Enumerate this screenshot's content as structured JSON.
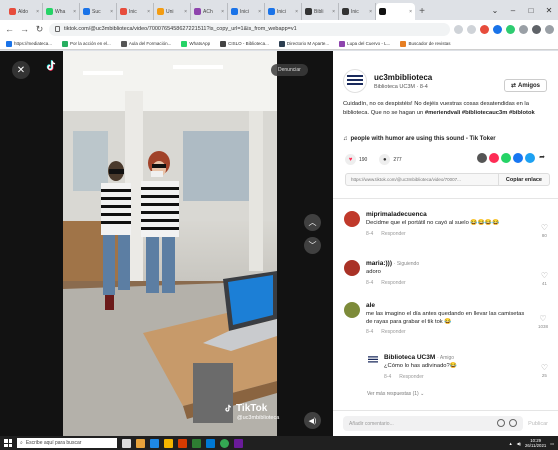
{
  "browser": {
    "tabs": [
      {
        "label": "Aldo",
        "color": "#e74c3c"
      },
      {
        "label": "Wha",
        "color": "#25d366"
      },
      {
        "label": "Suc",
        "color": "#1a73e8"
      },
      {
        "label": "Inic",
        "color": "#e74c3c"
      },
      {
        "label": "Uni",
        "color": "#f39c12"
      },
      {
        "label": "ACh",
        "color": "#8e44ad"
      },
      {
        "label": "Inici",
        "color": "#1a73e8"
      },
      {
        "label": "Inici",
        "color": "#1a73e8"
      },
      {
        "label": "Bibli",
        "color": "#333333"
      },
      {
        "label": "Inic",
        "color": "#333333"
      },
      {
        "label": "",
        "color": "#111111",
        "active": true
      }
    ],
    "new_tab": "+",
    "url": "tiktok.com/@uc3mbiblioteca/video/7000765458627221511?is_copy_url=1&is_from_webapp=v1",
    "bookmarks": [
      {
        "label": "https://mediateca...",
        "color": "#1a73e8"
      },
      {
        "label": "Por la acción en el...",
        "color": "#27ae60"
      },
      {
        "label": "Aula del Formación...",
        "color": "#555555"
      },
      {
        "label": "WhatsApp",
        "color": "#25d366"
      },
      {
        "label": "CISLO - Biblioteca...",
        "color": "#444444"
      },
      {
        "label": "Directorio M Aparte...",
        "color": "#2c3e50"
      },
      {
        "label": "Lupa del Cuervo - L...",
        "color": "#8e44ad"
      },
      {
        "label": "Buscador de revistas",
        "color": "#e67e22"
      }
    ]
  },
  "video": {
    "report_label": "Denunciar",
    "watermark_brand": "TikTok",
    "watermark_handle": "@uc3mbiblioteca"
  },
  "post": {
    "author_name": "uc3mbiblioteca",
    "author_sub": "Biblioteca UC3M · 8-4",
    "follow_label": "Amigos",
    "description": "Cuidadín, no os despistéis! No dejéis vuestras cosas desatendidas en la biblioteca. Que no se hagan un ",
    "hashtags": "#meriendvali #bibliotecauc3m #biblotok",
    "music": "people with humor are using this sound - Tik Toker",
    "likes": "190",
    "comments_count": "277",
    "link": "https://www.tiktok.com/@uc3mbiblioteca/video/70007...",
    "copy_label": "Copiar enlace"
  },
  "comments": [
    {
      "name": "miprimaladecuenca",
      "tag": "",
      "text": "Decidme que el portátil no cayó al suelo 😂😂😂😂",
      "date": "8-4",
      "reply_label": "Responder",
      "likes": "80",
      "color": "#c0392b"
    },
    {
      "name": "maria:)))",
      "tag": "· Siguiendo",
      "text": "adoro",
      "date": "8-4",
      "reply_label": "Responder",
      "likes": "41",
      "color": "#a93226"
    },
    {
      "name": "ale",
      "tag": "",
      "text": "me las imagino el día antes quedando en llevar las camisetas de rayas para grabar el tik tok 😂",
      "date": "8-4",
      "reply_label": "Responder",
      "likes": "1038",
      "color": "#7d8b3a"
    }
  ],
  "reply": {
    "name": "Biblioteca UC3M",
    "tag": "· Amigo",
    "text": "¿Cómo lo has adivinado?😂",
    "date": "8-4",
    "reply_label": "Responder",
    "likes": "25"
  },
  "more_replies": "Ver más respuestas (1) ⌄",
  "comment_input": {
    "placeholder": "Añadir comentario...",
    "post_label": "Publicar"
  },
  "taskbar": {
    "search_placeholder": "Escribe aquí para buscar",
    "time": "10:29",
    "date": "26/11/2021"
  }
}
